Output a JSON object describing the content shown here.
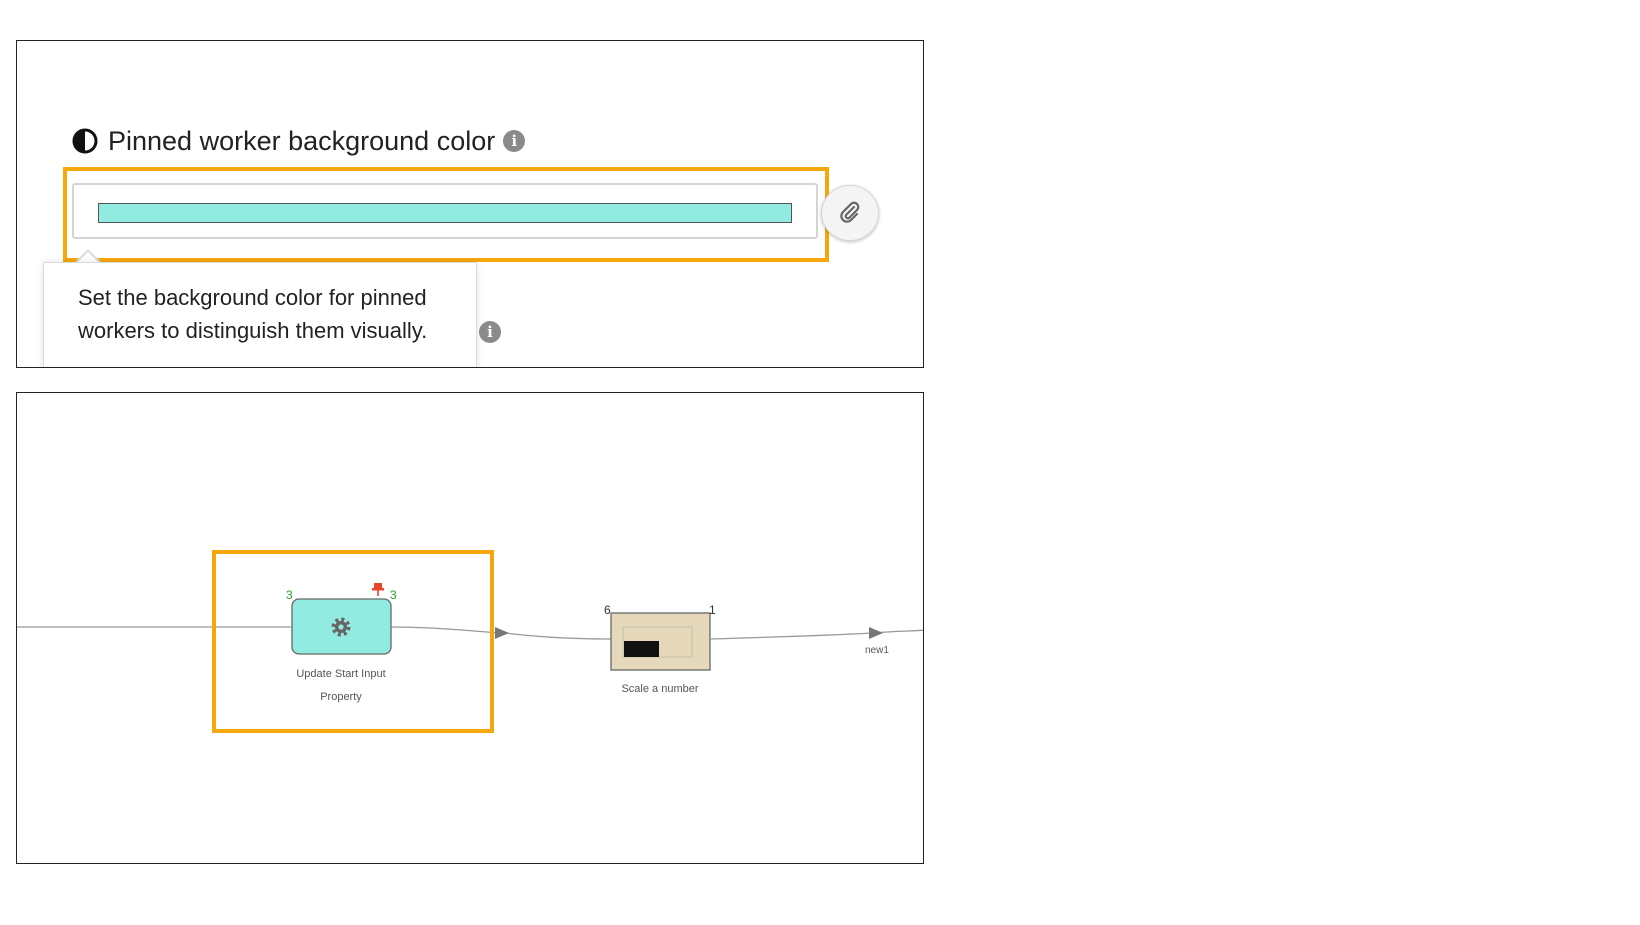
{
  "settings": {
    "heading": "Pinned worker background color",
    "color_value": "#92ebe1",
    "tooltip_text": "Set the background color for pinned workers to distinguish them visually.",
    "highlight_color": "#f5a70c"
  },
  "workflow": {
    "pinned_node": {
      "label_line1": "Update Start Input",
      "label_line2": "Property",
      "input_count": "3",
      "output_count": "3",
      "fill_color": "#92ebe1",
      "icon": "gear-icon",
      "pin_icon": "pin-icon"
    },
    "scale_node": {
      "label": "Scale a number",
      "input_count": "6",
      "output_count": "1",
      "fill_color": "#e5d8bb"
    },
    "output_label": "new1"
  },
  "colors": {
    "accent": "#f5a70c",
    "count_green": "#2a9d2a",
    "pin_red": "#e8452c"
  }
}
